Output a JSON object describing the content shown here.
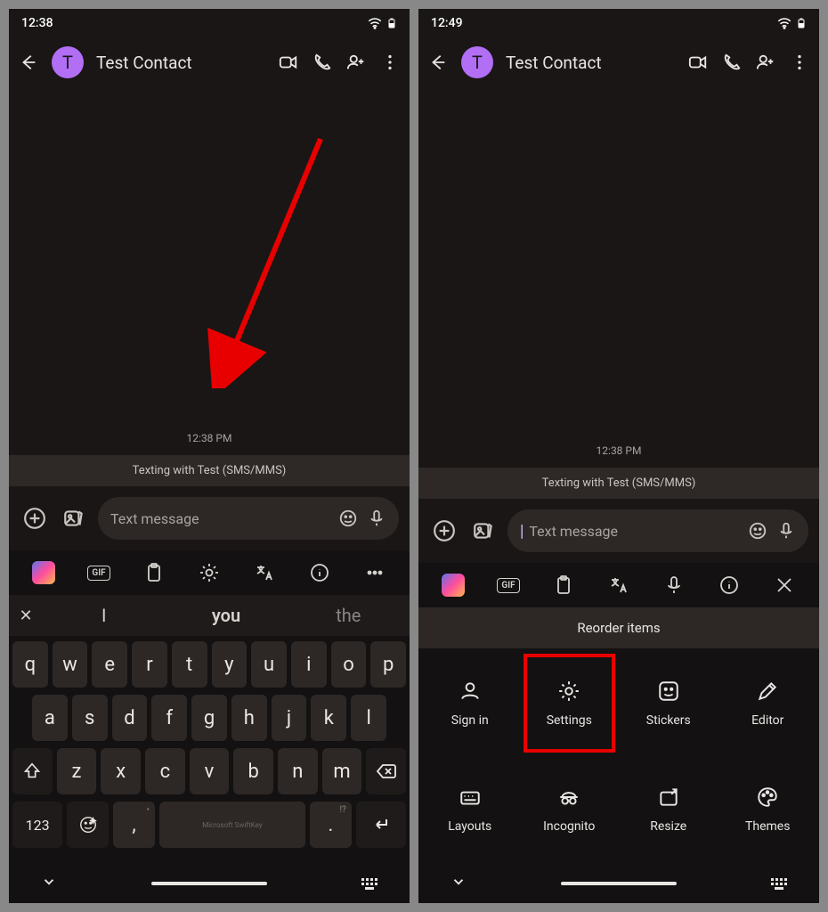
{
  "left": {
    "status_time": "12:38",
    "contact_initial": "T",
    "contact_name": "Test Contact",
    "thread_timestamp": "12:38 PM",
    "texting_banner": "Texting with Test (SMS/MMS)",
    "input_placeholder": "Text message",
    "suggestions": {
      "close": "✕",
      "w1": "I",
      "w2": "you",
      "w3": "the"
    },
    "keyboard_brand": "Microsoft SwiftKey",
    "keys": {
      "row1": [
        "q",
        "w",
        "e",
        "r",
        "t",
        "y",
        "u",
        "i",
        "o",
        "p"
      ],
      "row2": [
        "a",
        "s",
        "d",
        "f",
        "g",
        "h",
        "j",
        "k",
        "l"
      ],
      "row3_letters": [
        "z",
        "x",
        "c",
        "v",
        "b",
        "n",
        "m"
      ],
      "num_key": "123",
      "comma": ",",
      "period": ".",
      "period_hint": "!?"
    }
  },
  "right": {
    "status_time": "12:49",
    "contact_initial": "T",
    "contact_name": "Test Contact",
    "thread_timestamp": "12:38 PM",
    "texting_banner": "Texting with Test (SMS/MMS)",
    "input_placeholder": "Text message",
    "reorder_header": "Reorder items",
    "menu": {
      "signin": "Sign in",
      "settings": "Settings",
      "stickers": "Stickers",
      "editor": "Editor",
      "layouts": "Layouts",
      "incognito": "Incognito",
      "resize": "Resize",
      "themes": "Themes"
    }
  }
}
